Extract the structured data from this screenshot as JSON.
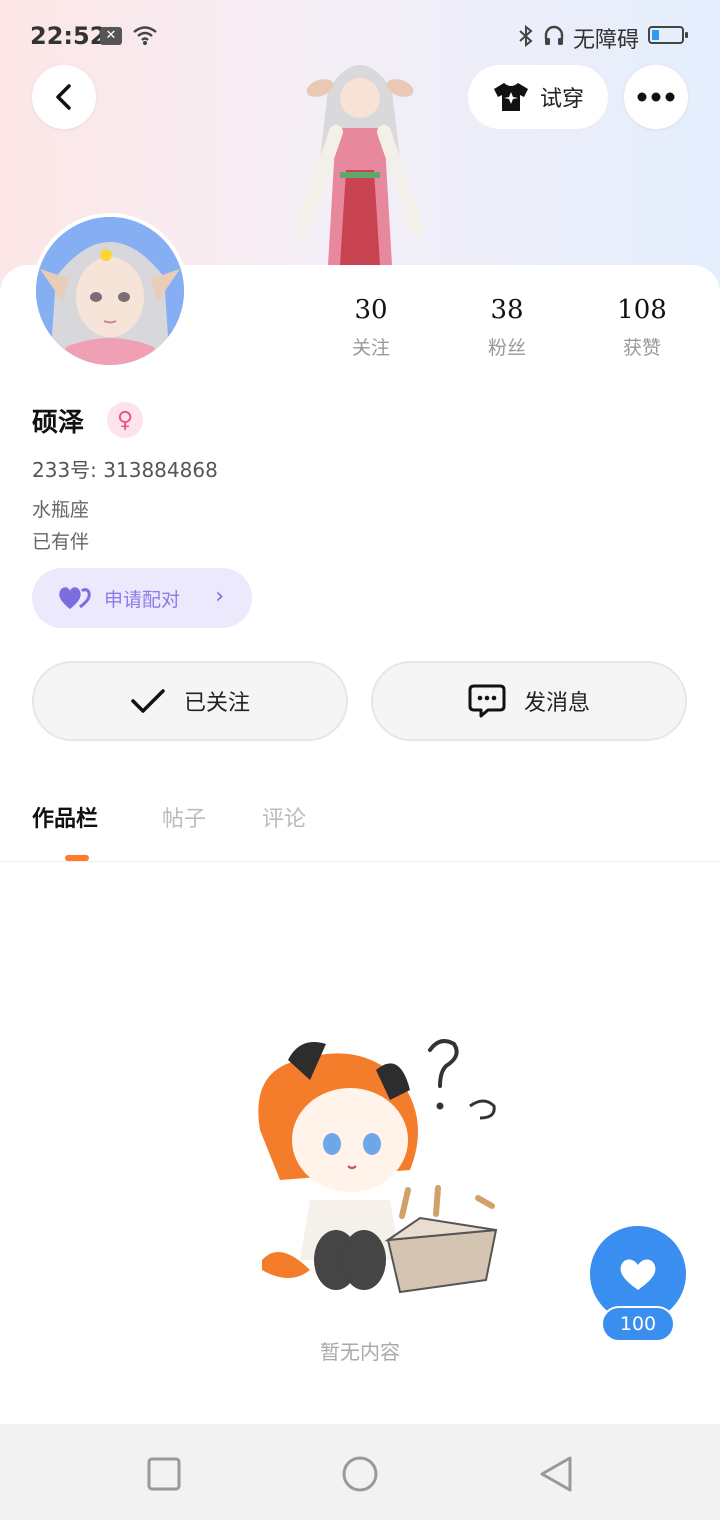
{
  "status_bar": {
    "time": "22:52",
    "accessibility": "无障碍",
    "battery_level": 0.25
  },
  "header": {
    "try_on_label": "试穿"
  },
  "profile": {
    "stats": [
      {
        "value": "30",
        "label": "关注"
      },
      {
        "value": "38",
        "label": "粉丝"
      },
      {
        "value": "108",
        "label": "获赞"
      }
    ],
    "name": "硕泽",
    "gender_symbol": "♀",
    "uid": "233号: 313884868",
    "zodiac": "水瓶座",
    "relationship": "已有伴",
    "apply_label": "申请配对"
  },
  "actions": {
    "follow_label": "已关注",
    "message_label": "发消息"
  },
  "tabs": [
    {
      "label": "作品栏",
      "active": true
    },
    {
      "label": "帖子",
      "active": false
    },
    {
      "label": "评论",
      "active": false
    }
  ],
  "empty_state": {
    "text": "暂无内容"
  },
  "like": {
    "count": "100"
  },
  "colors": {
    "accent_blue": "#3a8ef0",
    "tab_indicator": "#ff7a2a",
    "apply_bg": "#ece9fc",
    "apply_icon": "#7b6ce0"
  }
}
